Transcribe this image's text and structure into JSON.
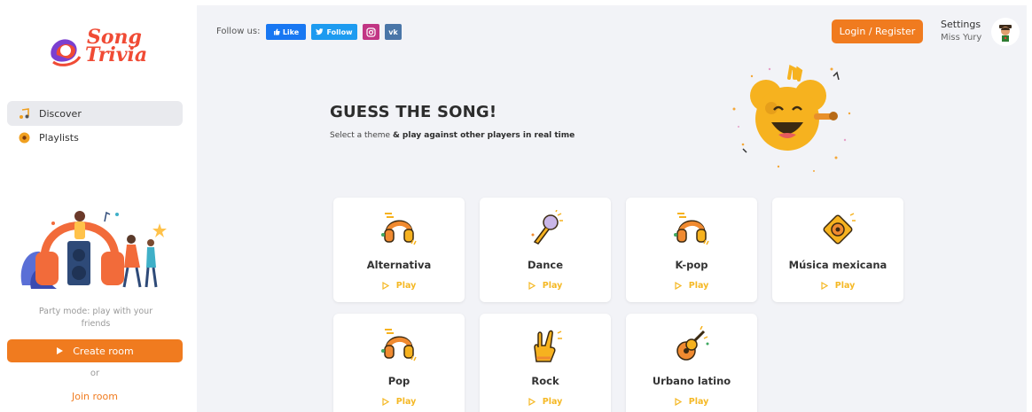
{
  "logo": {
    "line1": "Song",
    "line2": "Trivia"
  },
  "sidebar": {
    "items": [
      {
        "label": "Discover",
        "icon": "music-note-icon",
        "active": true
      },
      {
        "label": "Playlists",
        "icon": "vinyl-disc-icon",
        "active": false
      }
    ],
    "party_text_1": "Party mode: play with your",
    "party_text_2": "friends",
    "create_room": "Create room",
    "or": "or",
    "join_room": "Join room"
  },
  "header": {
    "follow_label": "Follow us:",
    "social": {
      "like": "Like",
      "follow": "Follow",
      "instagram_icon": "instagram-icon",
      "vk": "vk"
    },
    "login": "Login / Register",
    "settings": "Settings",
    "username": "Miss Yury"
  },
  "hero": {
    "title": "GUESS THE SONG!",
    "subtitle_plain": "Select a theme ",
    "subtitle_bold": "& play against other players in real time"
  },
  "play_label": "Play",
  "themes": [
    {
      "name": "Alternativa",
      "icon": "headphones-icon"
    },
    {
      "name": "Dance",
      "icon": "microphone-icon"
    },
    {
      "name": "K-pop",
      "icon": "headphones-icon"
    },
    {
      "name": "Música mexicana",
      "icon": "speaker-icon"
    },
    {
      "name": "Pop",
      "icon": "headphones-icon"
    },
    {
      "name": "Rock",
      "icon": "rock-hand-icon"
    },
    {
      "name": "Urbano latino",
      "icon": "guitar-icon"
    }
  ],
  "colors": {
    "accent": "#f07b1f",
    "play": "#f5b824",
    "brand": "#f04b35",
    "panel": "#f2f3f7"
  }
}
